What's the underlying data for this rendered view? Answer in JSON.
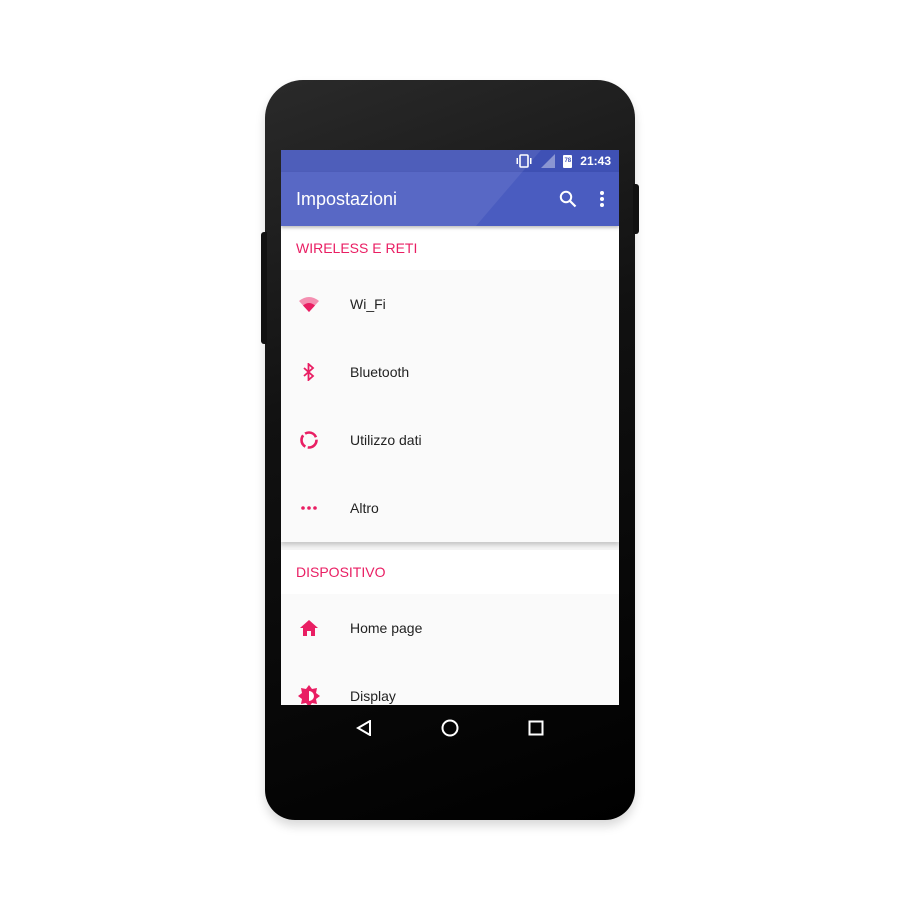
{
  "status_bar": {
    "time": "21:43",
    "battery_level": "78",
    "icons": [
      "vibrate-icon",
      "signal-icon",
      "battery-icon"
    ]
  },
  "toolbar": {
    "title": "Impostazioni",
    "icons": [
      "search-icon",
      "more-vert-icon"
    ]
  },
  "sections": [
    {
      "header": "WIRELESS E RETI",
      "items": [
        {
          "label": "Wi_Fi",
          "icon": "wifi-icon"
        },
        {
          "label": "Bluetooth",
          "icon": "bluetooth-icon"
        },
        {
          "label": "Utilizzo dati",
          "icon": "data-usage-icon"
        },
        {
          "label": "Altro",
          "icon": "more-horiz-icon"
        }
      ]
    },
    {
      "header": "DISPOSITIVO",
      "items": [
        {
          "label": "Home page",
          "icon": "home-icon"
        },
        {
          "label": "Display",
          "icon": "brightness-icon"
        }
      ]
    }
  ],
  "nav": [
    "back-icon",
    "home-icon",
    "recents-icon"
  ],
  "colors": {
    "primary": "#3f51b5",
    "accent": "#e91e63"
  }
}
